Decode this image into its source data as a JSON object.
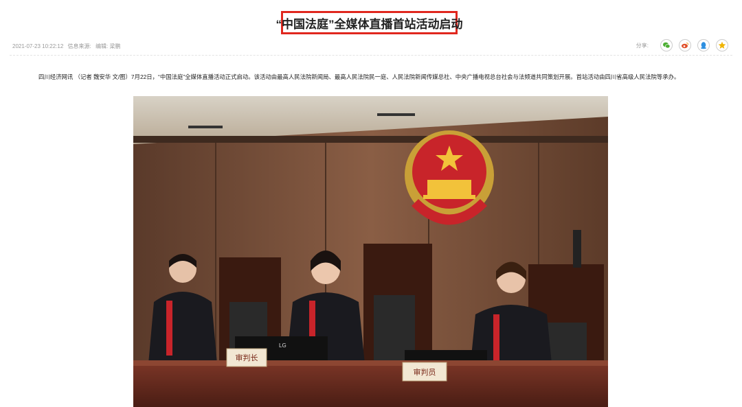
{
  "article": {
    "title": "“中国法庭”全媒体直播首站活动启动",
    "date": "2021-07-23 10:22:12",
    "source_label": "信息来源:",
    "editor_label": "编辑: 梁鹏",
    "lead": "四川经济网讯 （记者 魏安华 文/图）7月22日，“中国法庭”全媒体直播活动正式启动。该活动由最高人民法院新闻局、最高人民法院民一庭、人民法院新闻传媒总社、中央广播电视总台社会与法频道共同策划开展。首站活动由四川省高级人民法院等承办。"
  },
  "share": {
    "label": "分享:",
    "buttons": [
      {
        "icon": "wechat-icon",
        "color": "#4cae33"
      },
      {
        "icon": "weibo-icon",
        "color": "#e0502b"
      },
      {
        "icon": "qq-icon",
        "color": "#2d8fe0"
      },
      {
        "icon": "favorite-star-icon",
        "color": "#f0b400"
      }
    ]
  },
  "photo": {
    "nameplate_left": "审判长",
    "nameplate_right": "审判员",
    "monitor_brand": "LG"
  }
}
